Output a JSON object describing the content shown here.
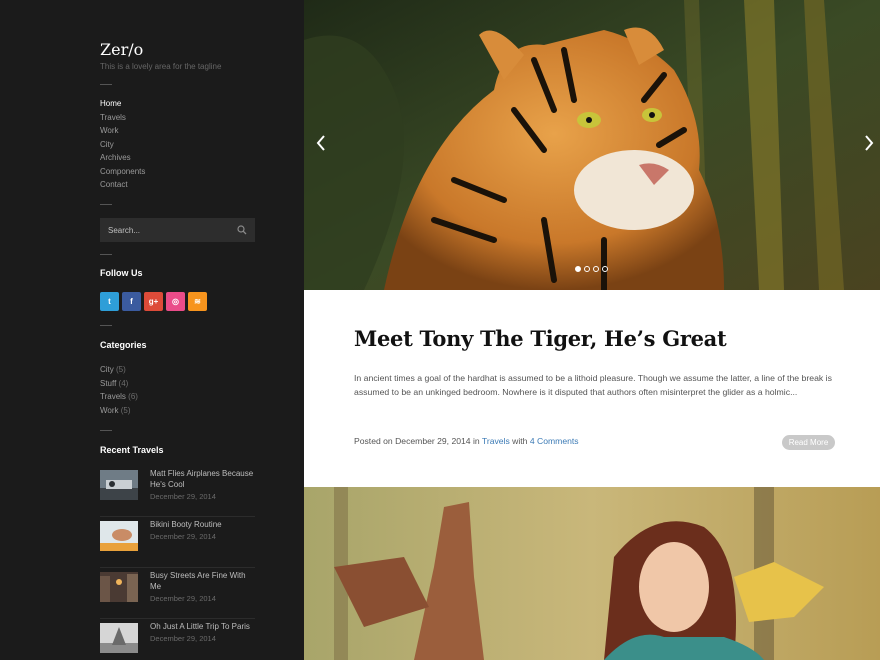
{
  "site": {
    "title": "Zer/o",
    "tagline": "This is a lovely area for the tagline"
  },
  "nav": {
    "items": [
      {
        "label": "Home"
      },
      {
        "label": "Travels"
      },
      {
        "label": "Work"
      },
      {
        "label": "City"
      },
      {
        "label": "Archives"
      },
      {
        "label": "Components"
      },
      {
        "label": "Contact"
      }
    ]
  },
  "search": {
    "placeholder": "Search..."
  },
  "follow": {
    "heading": "Follow Us",
    "networks": [
      {
        "icon": "twitter-icon",
        "glyph": "t",
        "color": "#2e9ed8"
      },
      {
        "icon": "facebook-icon",
        "glyph": "f",
        "color": "#3b5b9f"
      },
      {
        "icon": "google-plus-icon",
        "glyph": "g+",
        "color": "#dd4b39"
      },
      {
        "icon": "dribbble-icon",
        "glyph": "◎",
        "color": "#ea4c89"
      },
      {
        "icon": "rss-icon",
        "glyph": "≋",
        "color": "#f7941d"
      }
    ]
  },
  "categories": {
    "heading": "Categories",
    "items": [
      {
        "name": "City",
        "count": "(5)"
      },
      {
        "name": "Stuff",
        "count": "(4)"
      },
      {
        "name": "Travels",
        "count": "(6)"
      },
      {
        "name": "Work",
        "count": "(5)"
      }
    ]
  },
  "recent": {
    "heading": "Recent Travels",
    "items": [
      {
        "title": "Matt Flies Airplanes Because He's Cool",
        "date": "December 29, 2014"
      },
      {
        "title": "Bikini Booty Routine",
        "date": "December 29, 2014"
      },
      {
        "title": "Busy Streets Are Fine With Me",
        "date": "December 29, 2014"
      },
      {
        "title": "Oh Just A Little Trip To Paris",
        "date": "December 29, 2014"
      }
    ]
  },
  "slider": {
    "prev_icon": "chevron-left-icon",
    "next_icon": "chevron-right-icon",
    "slide_count": 4,
    "active_index": 0
  },
  "post": {
    "title": "Meet Tony The Tiger, He’s Great",
    "excerpt": "In ancient times a goal of the hardhat is assumed to be a lithoid pleasure. Though we assume the latter, a line of the break is assumed to be an unkinged bedroom. Nowhere is it disputed that authors often misinterpret the glider as a holmic...",
    "posted_prefix": "Posted on",
    "date": "December 29, 2014",
    "in_word": "in",
    "category": "Travels",
    "with_word": "with",
    "comments": "4 Comments",
    "read_more": "Read More"
  },
  "colors": {
    "sidebar_bg": "#1b1b1b",
    "link": "#3b7ab5"
  }
}
